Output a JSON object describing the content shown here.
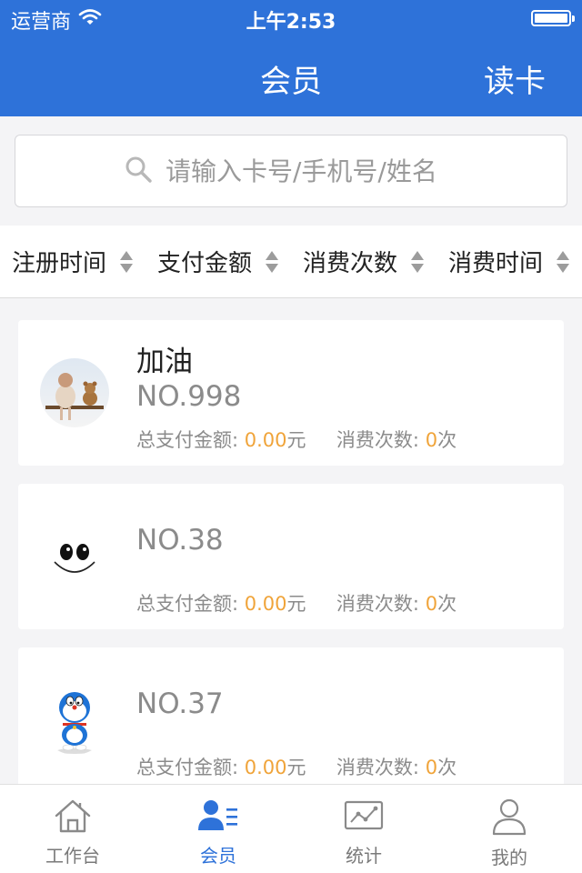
{
  "status_bar": {
    "carrier": "运营商",
    "time": "上午2:53",
    "battery_level": 1.0
  },
  "nav": {
    "title": "会员",
    "read_card": "读卡"
  },
  "search": {
    "placeholder": "请输入卡号/手机号/姓名",
    "value": ""
  },
  "sort_options": [
    {
      "label": "注册时间"
    },
    {
      "label": "支付金额"
    },
    {
      "label": "消费次数"
    },
    {
      "label": "消费时间"
    }
  ],
  "members": [
    {
      "name": "加油",
      "number": "NO.998",
      "total_pay_label": "总支付金额:",
      "total_pay_value": "0.00",
      "total_pay_unit": "元",
      "visits_label": "消费次数:",
      "visits_value": "0",
      "visits_unit": "次",
      "avatar": "baby-and-teddy-bear-photo"
    },
    {
      "name": "",
      "number": "NO.38",
      "total_pay_label": "总支付金额:",
      "total_pay_value": "0.00",
      "total_pay_unit": "元",
      "visits_label": "消费次数:",
      "visits_value": "0",
      "visits_unit": "次",
      "avatar": "smiley-face-drawing"
    },
    {
      "name": "",
      "number": "NO.37",
      "total_pay_label": "总支付金额:",
      "total_pay_value": "0.00",
      "total_pay_unit": "元",
      "visits_label": "消费次数:",
      "visits_value": "0",
      "visits_unit": "次",
      "avatar": "doraemon-figure"
    }
  ],
  "tabs": [
    {
      "label": "工作台",
      "icon": "home-icon"
    },
    {
      "label": "会员",
      "icon": "members-icon",
      "active": true
    },
    {
      "label": "统计",
      "icon": "chart-icon"
    },
    {
      "label": "我的",
      "icon": "user-icon"
    }
  ],
  "colors": {
    "brand": "#2e72d9",
    "accent": "#f0a43a",
    "text_muted": "#8b8b8b"
  }
}
